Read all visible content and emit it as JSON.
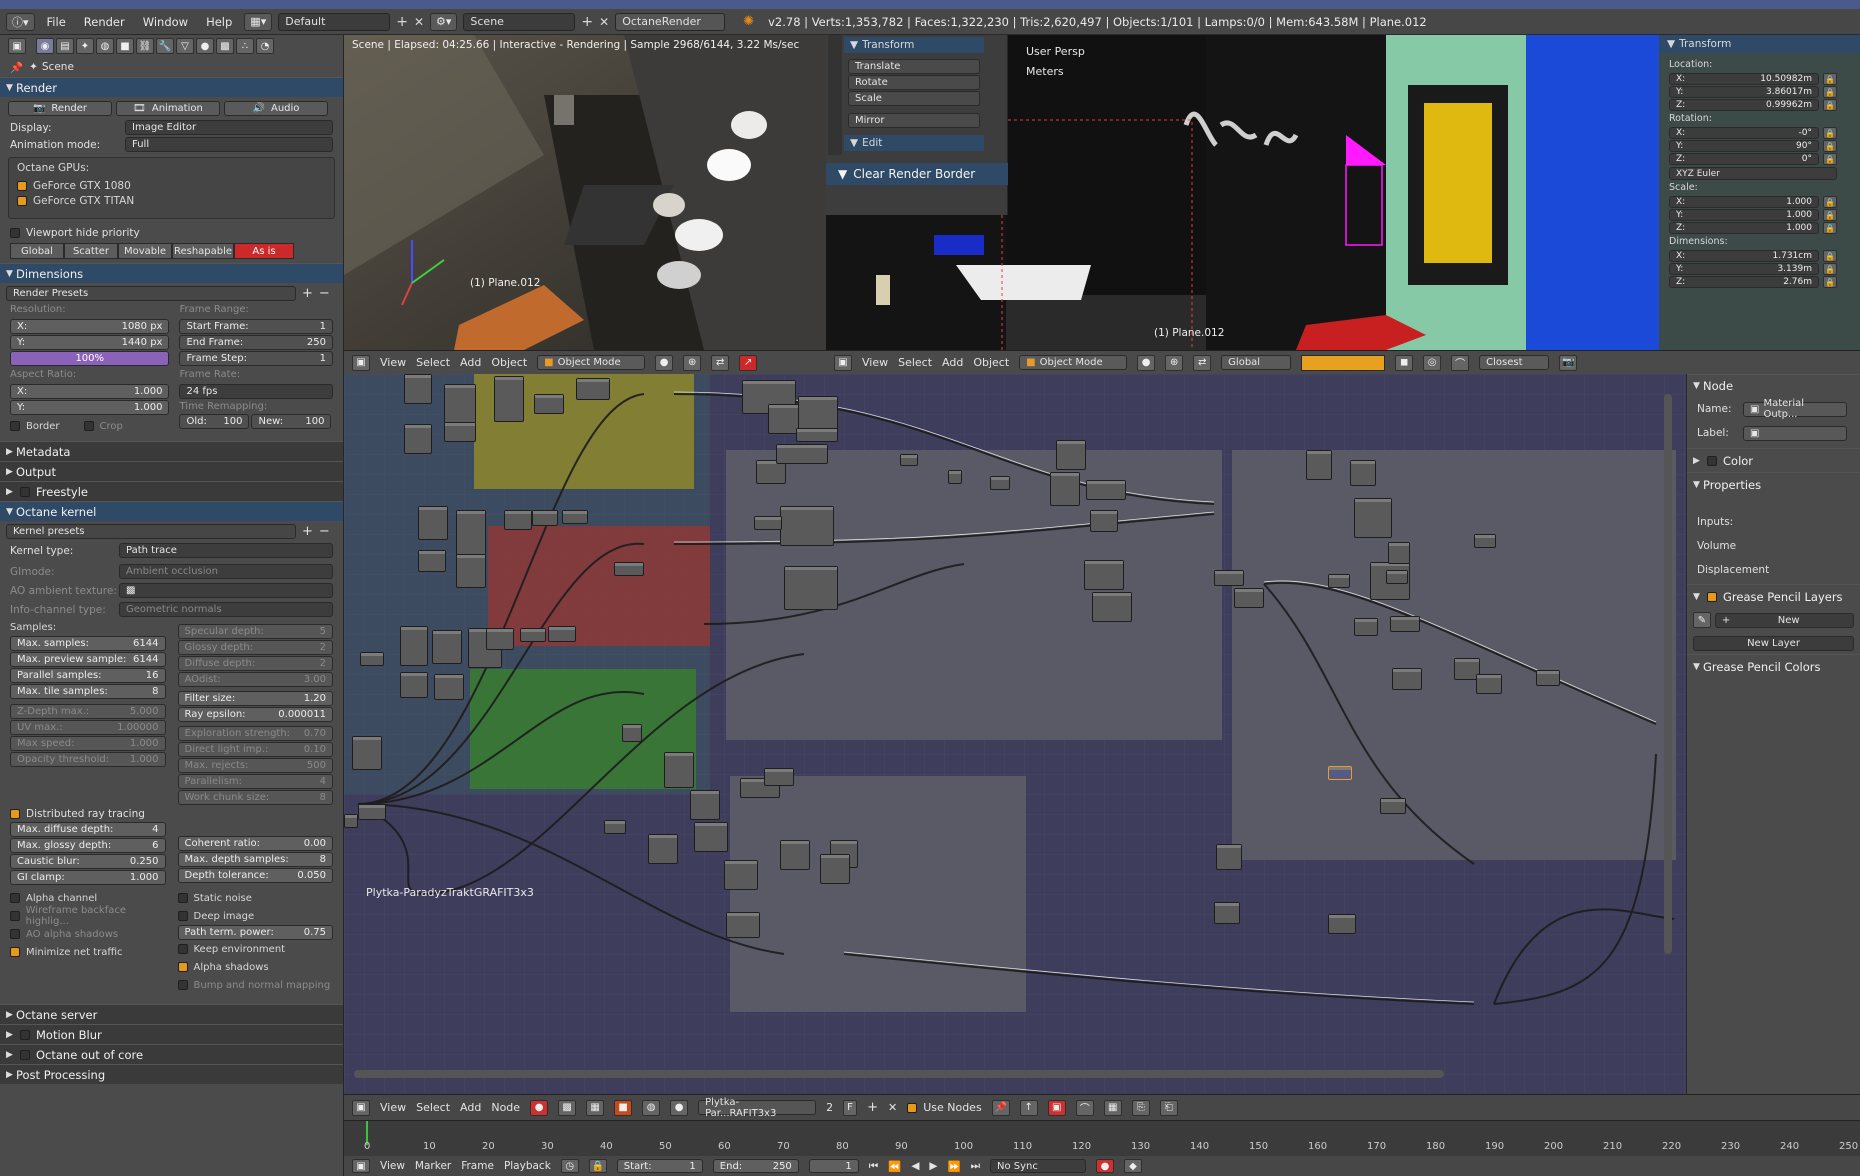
{
  "topbar": {
    "menus": [
      "File",
      "Render",
      "Window",
      "Help"
    ],
    "layout": "Default",
    "scene": "Scene",
    "engine": "OctaneRender",
    "stats": "v2.78 | Verts:1,353,782 | Faces:1,322,230 | Tris:2,620,497 | Objects:1/101 | Lamps:0/0 | Mem:643.58M | Plane.012"
  },
  "left": {
    "breadcrumb": "Scene",
    "render": {
      "header": "Render",
      "buttons": [
        "Render",
        "Animation",
        "Audio"
      ],
      "display_label": "Display:",
      "display_value": "Image Editor",
      "anim_label": "Animation mode:",
      "anim_value": "Full",
      "gpus_label": "Octane GPUs:",
      "gpus": [
        "GeForce GTX 1080",
        "GeForce GTX TITAN"
      ],
      "viewport_hide": "Viewport hide priority",
      "priority_tabs": [
        "Global",
        "Scatter",
        "Movable",
        "Reshapable",
        "As is"
      ]
    },
    "dimensions": {
      "header": "Dimensions",
      "presets": "Render Presets",
      "resolution_label": "Resolution:",
      "res_x_label": "X:",
      "res_x": "1080 px",
      "res_y_label": "Y:",
      "res_y": "1440 px",
      "res_pct": "100%",
      "aspect_label": "Aspect Ratio:",
      "asp_x_label": "X:",
      "asp_x": "1.000",
      "asp_y_label": "Y:",
      "asp_y": "1.000",
      "border": "Border",
      "crop": "Crop",
      "frame_range_label": "Frame Range:",
      "start_label": "Start Frame:",
      "start": "1",
      "end_label": "End Frame:",
      "end": "250",
      "step_label": "Frame Step:",
      "step": "1",
      "fps_label": "Frame Rate:",
      "fps": "24 fps",
      "remap_label": "Time Remapping:",
      "old_label": "Old:",
      "old": "100",
      "new_label": "New:",
      "new": "100"
    },
    "collapsed1": [
      "Metadata",
      "Output",
      "Freestyle"
    ],
    "kernel": {
      "header": "Octane kernel",
      "presets": "Kernel presets",
      "type_label": "Kernel type:",
      "type": "Path trace",
      "gimode_label": "GImode:",
      "gimode": "Ambient occlusion",
      "ao_tex_label": "AO ambient texture:",
      "info_label": "Info-channel type:",
      "info": "Geometric normals",
      "samples_label": "Samples:",
      "left_fields": [
        [
          "Max. samples:",
          "6144"
        ],
        [
          "Max. preview sample:",
          "6144"
        ],
        [
          "Parallel samples:",
          "16"
        ],
        [
          "Max. tile samples:",
          "8"
        ],
        [
          "Z-Depth max.:",
          "5.000"
        ],
        [
          "UV max.:",
          "1.00000"
        ],
        [
          "Max speed:",
          "1.000"
        ],
        [
          "Opacity threshold:",
          "1.000"
        ]
      ],
      "right_fields": [
        [
          "Specular depth:",
          "5"
        ],
        [
          "Glossy depth:",
          "2"
        ],
        [
          "Diffuse depth:",
          "2"
        ],
        [
          "AOdist:",
          "3.00"
        ],
        [
          "Filter size:",
          "1.20"
        ],
        [
          "Ray epsilon:",
          "0.000011"
        ],
        [
          "Exploration strength:",
          "0.70"
        ],
        [
          "Direct light imp.:",
          "0.10"
        ],
        [
          "Max. rejects:",
          "500"
        ],
        [
          "Parallelism:",
          "4"
        ],
        [
          "Work chunk size:",
          "8"
        ]
      ],
      "distributed": "Distributed ray tracing",
      "left_fields2": [
        [
          "Max. diffuse depth:",
          "4"
        ],
        [
          "Max. glossy depth:",
          "6"
        ],
        [
          "Caustic blur:",
          "0.250"
        ],
        [
          "GI clamp:",
          "1.000"
        ]
      ],
      "right_fields2": [
        [
          "Coherent ratio:",
          "0.00"
        ],
        [
          "Max. depth samples:",
          "8"
        ],
        [
          "Depth tolerance:",
          "0.050"
        ]
      ],
      "left_checks": [
        "Alpha channel",
        "Wireframe backface highlig...",
        "AO alpha shadows",
        "Minimize net traffic"
      ],
      "right_checks": [
        "Static noise",
        "Deep image",
        "Keep environment",
        "Alpha shadows",
        "Bump and normal mapping"
      ],
      "term_label": "Path term. power:",
      "term": "0.75"
    },
    "collapsed2": [
      "Octane server",
      "Motion Blur",
      "Octane out of core",
      "Post Processing"
    ]
  },
  "vp1": {
    "status": "Scene | Elapsed: 04:25.66 | Interactive - Rendering | Sample 2968/6144, 3.22 Ms/sec",
    "object_label": "(1) Plane.012",
    "header": [
      "View",
      "Select",
      "Add",
      "Object"
    ],
    "mode": "Object Mode"
  },
  "vp2": {
    "tool_sections": [
      "Transform",
      "Edit"
    ],
    "tool_buttons": [
      "Translate",
      "Rotate",
      "Scale",
      "Mirror"
    ],
    "clear_border": "Clear Render Border",
    "persp": "User Persp",
    "units": "Meters",
    "object_label": "(1) Plane.012",
    "header": [
      "View",
      "Select",
      "Add",
      "Object"
    ],
    "mode": "Object Mode",
    "orientation": "Global",
    "snap": "Closest"
  },
  "npanel": {
    "header": "Transform",
    "location_label": "Location:",
    "location": [
      [
        "X:",
        "10.50982m"
      ],
      [
        "Y:",
        "3.86017m"
      ],
      [
        "Z:",
        "0.99962m"
      ]
    ],
    "rotation_label": "Rotation:",
    "rotation": [
      [
        "X:",
        "-0°"
      ],
      [
        "Y:",
        "90°"
      ],
      [
        "Z:",
        "0°"
      ]
    ],
    "rot_mode": "XYZ Euler",
    "scale_label": "Scale:",
    "scale": [
      [
        "X:",
        "1.000"
      ],
      [
        "Y:",
        "1.000"
      ],
      [
        "Z:",
        "1.000"
      ]
    ],
    "dim_label": "Dimensions:",
    "dims": [
      [
        "X:",
        "1.731cm"
      ],
      [
        "Y:",
        "3.139m"
      ],
      [
        "Z:",
        "2.76m"
      ]
    ]
  },
  "nodeside": {
    "node_header": "Node",
    "name_label": "Name:",
    "name": "Material Outp...",
    "label_label": "Label:",
    "color": "Color",
    "properties": "Properties",
    "inputs": "Inputs:",
    "volume": "Volume",
    "displacement": "Displacement",
    "gp_layers": "Grease Pencil Layers",
    "new": "New",
    "new_layer": "New Layer",
    "gp_colors": "Grease Pencil Colors"
  },
  "nodeeditor": {
    "material_name": "Plytka-ParadyzTraktGRAFIT3x3"
  },
  "nodehead": {
    "menus": [
      "View",
      "Select",
      "Add",
      "Node"
    ],
    "material": "Plytka-Par...RAFIT3x3",
    "users": "2",
    "fake": "F",
    "use_nodes": "Use Nodes"
  },
  "timeline": {
    "ticks": [
      "0",
      "10",
      "20",
      "30",
      "40",
      "50",
      "60",
      "70",
      "80",
      "90",
      "100",
      "110",
      "120",
      "130",
      "140",
      "150",
      "160",
      "170",
      "180",
      "190",
      "200",
      "210",
      "220",
      "230",
      "240",
      "250"
    ]
  },
  "timehead": {
    "menus": [
      "View",
      "Marker",
      "Frame",
      "Playback"
    ],
    "start_label": "Start:",
    "start": "1",
    "end_label": "End:",
    "end": "250",
    "current": "1",
    "sync": "No Sync"
  },
  "colors": {
    "accent_blue": "#2e4a66",
    "active_red": "#cc2a2a",
    "checkbox_on": "#e69a1a",
    "node_bg": "#3f3d5c"
  }
}
